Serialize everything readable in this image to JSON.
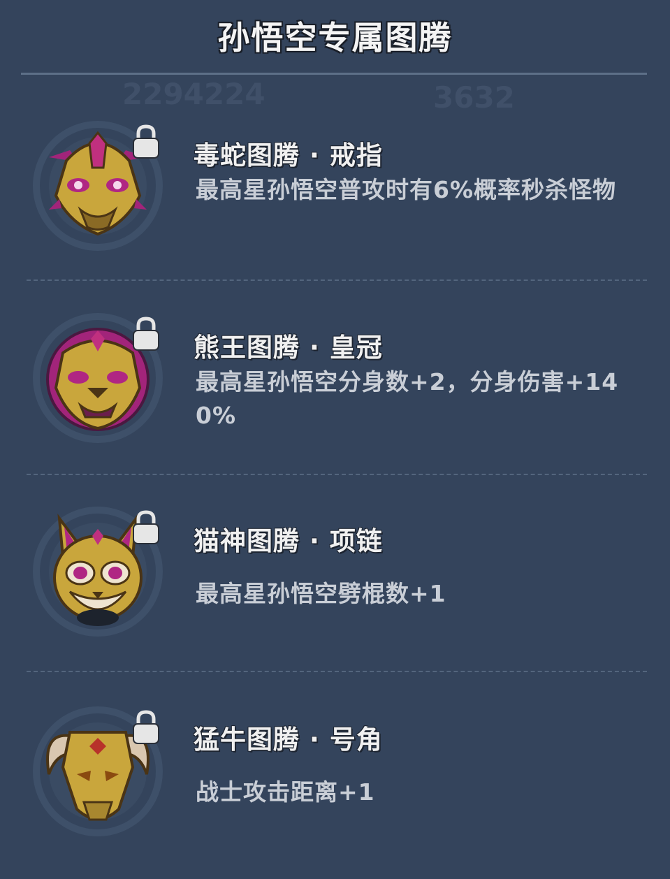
{
  "page": {
    "title": "孙悟空专属图腾"
  },
  "totems": [
    {
      "name": "毒蛇图腾 · 戒指",
      "desc": "最高星孙悟空普攻时有6%概率秒杀怪物",
      "icon": "snake-mask-icon",
      "locked": true
    },
    {
      "name": "熊王图腾 · 皇冠",
      "desc": "最高星孙悟空分身数+2，分身伤害+140%",
      "icon": "lion-mask-icon",
      "locked": true
    },
    {
      "name": "猫神图腾 · 项链",
      "desc": "最高星孙悟空劈棍数+1",
      "icon": "cat-mask-icon",
      "locked": true
    },
    {
      "name": "猛牛图腾 · 号角",
      "desc": "战士攻击距离+1",
      "icon": "bull-mask-icon",
      "locked": true
    }
  ],
  "colors": {
    "background": "#34445c",
    "gold": "#c9a63c",
    "magenta": "#a2247a",
    "text": "#c9ced6"
  }
}
